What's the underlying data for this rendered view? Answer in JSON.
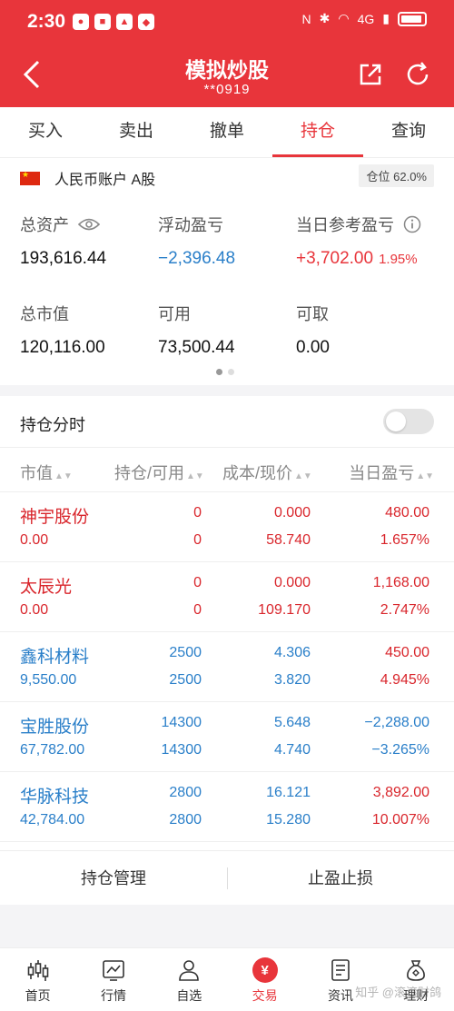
{
  "status_bar": {
    "time": "2:30",
    "network": "4G"
  },
  "header": {
    "title": "模拟炒股",
    "account": "**0919"
  },
  "tabs": [
    {
      "label": "买入"
    },
    {
      "label": "卖出"
    },
    {
      "label": "撤单"
    },
    {
      "label": "持仓",
      "active": true
    },
    {
      "label": "查询"
    }
  ],
  "account": {
    "label": "人民币账户 A股",
    "position_label": "仓位",
    "position_value": "62.0%"
  },
  "stats": {
    "total_assets": {
      "label": "总资产",
      "value": "193,616.44"
    },
    "floating_pl": {
      "label": "浮动盈亏",
      "value": "−2,396.48"
    },
    "daily_pl": {
      "label": "当日参考盈亏",
      "value": "+3,702.00",
      "pct": "1.95%"
    },
    "market_value": {
      "label": "总市值",
      "value": "120,116.00"
    },
    "available": {
      "label": "可用",
      "value": "73,500.44"
    },
    "withdrawable": {
      "label": "可取",
      "value": "0.00"
    }
  },
  "holding": {
    "title": "持仓分时",
    "columns": [
      "市值",
      "持仓/可用",
      "成本/现价",
      "当日盈亏"
    ],
    "rows": [
      {
        "name": "神宇股份",
        "market_value": "0.00",
        "qty": "0",
        "avail": "0",
        "cost": "0.000",
        "price": "58.740",
        "pl": "480.00",
        "pl_pct": "1.657%",
        "color": "red",
        "pl_color": "red"
      },
      {
        "name": "太辰光",
        "market_value": "0.00",
        "qty": "0",
        "avail": "0",
        "cost": "0.000",
        "price": "109.170",
        "pl": "1,168.00",
        "pl_pct": "2.747%",
        "color": "red",
        "pl_color": "red"
      },
      {
        "name": "鑫科材料",
        "market_value": "9,550.00",
        "qty": "2500",
        "avail": "2500",
        "cost": "4.306",
        "price": "3.820",
        "pl": "450.00",
        "pl_pct": "4.945%",
        "color": "blue",
        "pl_color": "red"
      },
      {
        "name": "宝胜股份",
        "market_value": "67,782.00",
        "qty": "14300",
        "avail": "14300",
        "cost": "5.648",
        "price": "4.740",
        "pl": "−2,288.00",
        "pl_pct": "−3.265%",
        "color": "blue",
        "pl_color": "blue"
      },
      {
        "name": "华脉科技",
        "market_value": "42,784.00",
        "qty": "2800",
        "avail": "2800",
        "cost": "16.121",
        "price": "15.280",
        "pl": "3,892.00",
        "pl_pct": "10.007%",
        "color": "blue",
        "pl_color": "red"
      }
    ]
  },
  "actions": {
    "manage": "持仓管理",
    "stop": "止盈止损"
  },
  "nav": [
    {
      "label": "首页",
      "icon": "candlestick-icon"
    },
    {
      "label": "行情",
      "icon": "chart-icon"
    },
    {
      "label": "自选",
      "icon": "person-icon"
    },
    {
      "label": "交易",
      "icon": "yuan-icon",
      "active": true,
      "glyph": "¥"
    },
    {
      "label": "资讯",
      "icon": "document-icon"
    },
    {
      "label": "理财",
      "icon": "moneybag-icon"
    }
  ],
  "watermark": "知乎 @滚滚财鸽",
  "colors": {
    "brand": "#e8353b",
    "up": "#d9262c",
    "down": "#2a7fc9"
  }
}
